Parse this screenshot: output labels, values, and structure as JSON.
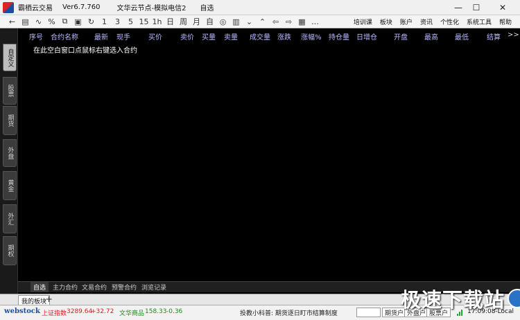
{
  "window": {
    "app_name": "霸栖云交易",
    "version": "Ver6.7.760",
    "node": "文华云节点-模拟电信2",
    "mode": "自选",
    "controls": {
      "minimize": "—",
      "maximize": "☐",
      "close": "✕"
    }
  },
  "toolbar": {
    "buttons": [
      "←",
      "▤",
      "∿",
      "%",
      "⧉",
      "▣",
      "↻",
      "1",
      "3",
      "5",
      "15",
      "1h",
      "日",
      "周",
      "月",
      "自",
      "◎",
      "▥",
      "⌄",
      "⌃",
      "⇦",
      "⇨",
      "▦",
      "…"
    ],
    "menu": [
      "培训课",
      "板块",
      "账户",
      "资讯",
      "个性化",
      "系统工具",
      "帮助"
    ]
  },
  "side_tabs": [
    "自定义",
    "股票",
    "期货",
    "外盘",
    "黄金",
    "外汇",
    "期权"
  ],
  "table": {
    "columns": [
      "序号",
      "合约名称",
      "最新",
      "现手",
      "买价",
      "卖价",
      "买量",
      "卖量",
      "成交量",
      "涨跌",
      "涨幅%",
      "持仓量",
      "日增仓",
      "开盘",
      "最高",
      "最低",
      "结算"
    ],
    "more": ">>",
    "hint": "在此空白窗口点鼠标右键选入合约"
  },
  "sub_tabs": [
    "自选",
    "主力合约",
    "文易合约",
    "预警合约",
    "浏览记录"
  ],
  "board": {
    "tab": "我的板块",
    "add": "+"
  },
  "status": {
    "logo": "webstock",
    "index1_name": "上证指数",
    "index1_value": "3289.64",
    "index1_change": "+32.72",
    "index2_name": "文华商品",
    "index2_value": "158.33",
    "index2_change": "-0.36",
    "tip": "投教小科普: 期货逐日盯市结算制度",
    "btn1": "期货户",
    "btn2": "外盘户",
    "btn3": "股票户",
    "time": "17:09:08-Local",
    "colors": {
      "up": "#d42020",
      "down": "#1a8a1a"
    }
  },
  "watermark": {
    "text": "极速下载站"
  }
}
